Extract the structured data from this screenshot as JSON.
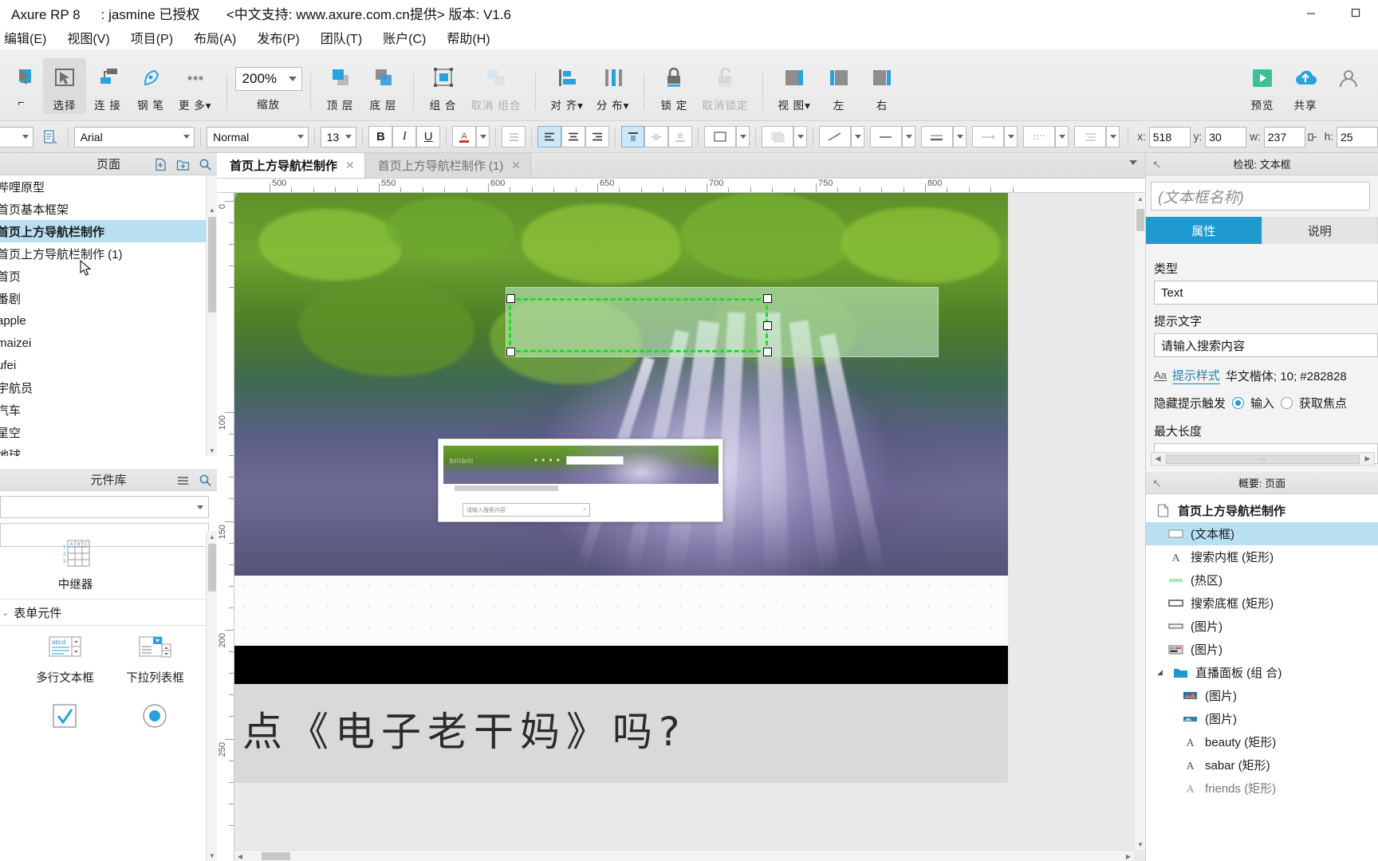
{
  "titlebar": {
    "app": "Axure RP 8",
    "license": ": jasmine 已授权",
    "support": "<中文支持: www.axure.com.cn提供> 版本: V1.6",
    "minimize": "minimize-icon",
    "maximize": "maximize-icon"
  },
  "menubar": {
    "items": [
      {
        "label": "编辑(E)",
        "name": "menu-edit"
      },
      {
        "label": "视图(V)",
        "name": "menu-view"
      },
      {
        "label": "项目(P)",
        "name": "menu-project"
      },
      {
        "label": "布局(A)",
        "name": "menu-layout"
      },
      {
        "label": "发布(P)",
        "name": "menu-publish"
      },
      {
        "label": "团队(T)",
        "name": "menu-team"
      },
      {
        "label": "账户(C)",
        "name": "menu-account"
      },
      {
        "label": "帮助(H)",
        "name": "menu-help"
      }
    ]
  },
  "toolbar": {
    "select": "选择",
    "connect": "连 接",
    "pen": "钢 笔",
    "more": "更 多",
    "zoom_value": "200%",
    "zoom_label": "缩放",
    "front": "顶 层",
    "back": "底 层",
    "group": "组 合",
    "ungroup": "取消 组合",
    "align": "对 齐",
    "distribute": "分 布",
    "lock": "锁 定",
    "unlock": "取消锁定",
    "view": "视 图",
    "left": "左",
    "right": "右",
    "preview": "预览",
    "share": "共享"
  },
  "formatbar": {
    "font": "Arial",
    "weight": "Normal",
    "size": "13",
    "bold": "B",
    "italic": "I",
    "underline": "U",
    "x_label": "x:",
    "x_value": "518",
    "y_label": "y:",
    "y_value": "30",
    "w_label": "w:",
    "w_value": "237",
    "h_label": "h:",
    "h_value": "25"
  },
  "pages_panel": {
    "title": "页面",
    "items": [
      {
        "label": "哔哩原型",
        "selected": false
      },
      {
        "label": "首页基本框架",
        "selected": false
      },
      {
        "label": "首页上方导航栏制作",
        "selected": true
      },
      {
        "label": "首页上方导航栏制作 (1)",
        "selected": false
      },
      {
        "label": "首页",
        "selected": false
      },
      {
        "label": "番剧",
        "selected": false
      },
      {
        "label": "apple",
        "selected": false
      },
      {
        "label": "maizei",
        "selected": false
      },
      {
        "label": "ufei",
        "selected": false
      },
      {
        "label": "宇航员",
        "selected": false
      },
      {
        "label": "汽车",
        "selected": false
      },
      {
        "label": "星空",
        "selected": false
      },
      {
        "label": "地球",
        "selected": false
      }
    ]
  },
  "library_panel": {
    "title": "元件库",
    "sections": [
      {
        "name": "repeater-section",
        "heading": "",
        "items": [
          {
            "label": "中继器",
            "icon": "table-grid-icon"
          }
        ]
      },
      {
        "name": "form-section",
        "heading": "表单元件",
        "items": [
          {
            "label": "多行文本框",
            "icon": "textarea-icon"
          },
          {
            "label": "下拉列表框",
            "icon": "dropdown-icon"
          },
          {
            "label": "",
            "icon": "checkbox-icon"
          },
          {
            "label": "",
            "icon": "radio-icon"
          }
        ]
      }
    ]
  },
  "canvas": {
    "tabs": [
      {
        "label": "首页上方导航栏制作",
        "active": true
      },
      {
        "label": "首页上方导航栏制作 (1)",
        "active": false
      }
    ],
    "ruler_h_labels": [
      "500",
      "550",
      "600",
      "650",
      "700",
      "750",
      "800"
    ],
    "ruler_v_labels": [
      "0",
      "100",
      "150",
      "200",
      "250"
    ],
    "artboard_text": "点《电子老干妈》吗?",
    "overlay": {
      "name": "page-preview-thumbnail",
      "search_placeholder": "请输入搜索内容"
    }
  },
  "inspector": {
    "title": "检视: 文本框",
    "name_placeholder": "(文本框名称)",
    "tabs": [
      {
        "label": "属性",
        "active": true
      },
      {
        "label": "说明",
        "active": false
      }
    ],
    "type_label": "类型",
    "type_value": "Text",
    "hint_label": "提示文字",
    "hint_value": "请输入搜索内容",
    "hint_style_link": "提示样式",
    "hint_style_meta": "华文楷体; 10; #282828",
    "hide_hint_label": "隐藏提示触发",
    "hide_hint_option_1": "输入",
    "hide_hint_option_2": "获取焦点",
    "hide_hint_selected": "输入",
    "maxlen_label": "最大长度",
    "maxlen_value": ""
  },
  "outline_panel": {
    "title": "概要: 页面",
    "root": "首页上方导航栏制作",
    "items": [
      {
        "label": "(文本框)",
        "icon": "textbox-icon",
        "indent": 1,
        "selected": true
      },
      {
        "label": "搜索内框 (矩形)",
        "icon": "text-a-icon",
        "indent": 1,
        "selected": false
      },
      {
        "label": "(热区)",
        "icon": "hotspot-icon",
        "indent": 1,
        "selected": false
      },
      {
        "label": "搜索底框 (矩形)",
        "icon": "rect-icon",
        "indent": 1,
        "selected": false
      },
      {
        "label": "(图片)",
        "icon": "image-icon",
        "indent": 1,
        "selected": false
      },
      {
        "label": "(图片)",
        "icon": "image-icon",
        "indent": 1,
        "selected": false
      },
      {
        "label": "直播面板 (组 合)",
        "icon": "folder-icon",
        "indent": 1,
        "selected": false
      },
      {
        "label": "(图片)",
        "icon": "image-icon",
        "indent": 2,
        "selected": false
      },
      {
        "label": "(图片)",
        "icon": "image-icon",
        "indent": 2,
        "selected": false
      },
      {
        "label": "beauty (矩形)",
        "icon": "text-a-icon",
        "indent": 2,
        "selected": false
      },
      {
        "label": "sabar (矩形)",
        "icon": "text-a-icon",
        "indent": 2,
        "selected": false
      },
      {
        "label": "friends (矩形)",
        "icon": "text-a-icon",
        "indent": 2,
        "selected": false
      }
    ]
  },
  "colors": {
    "accent": "#1e9ad1",
    "selection_blue": "#b9e0f2",
    "selection_green": "#22dd22",
    "preview_green": "#3fbf97"
  }
}
